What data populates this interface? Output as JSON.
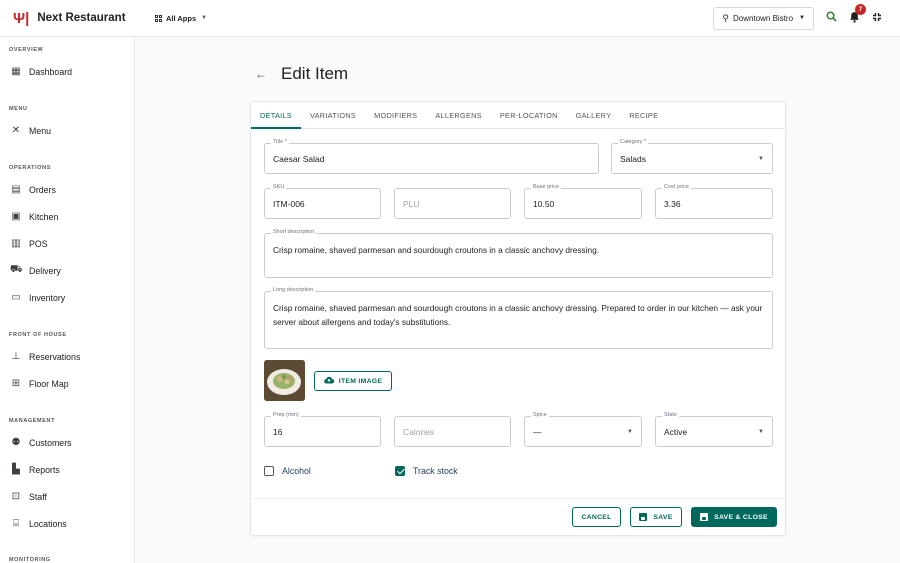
{
  "brand": {
    "name": "Next Restaurant",
    "icon": "fork-knife-icon"
  },
  "apps": {
    "label": "All Apps"
  },
  "location": {
    "label": "Downtown Bistro"
  },
  "notifications": {
    "count": "7"
  },
  "sidebar": {
    "sections": [
      {
        "title": "OVERVIEW",
        "items": [
          {
            "label": "Dashboard",
            "icon": "dashboard-icon"
          }
        ]
      },
      {
        "title": "MENU",
        "items": [
          {
            "label": "Menu",
            "icon": "utensils-icon"
          }
        ]
      },
      {
        "title": "OPERATIONS",
        "items": [
          {
            "label": "Orders",
            "icon": "receipt-icon"
          },
          {
            "label": "Kitchen",
            "icon": "kitchen-icon"
          },
          {
            "label": "POS",
            "icon": "register-icon"
          },
          {
            "label": "Delivery",
            "icon": "truck-icon"
          },
          {
            "label": "Inventory",
            "icon": "inventory-icon"
          }
        ]
      },
      {
        "title": "FRONT OF HOUSE",
        "items": [
          {
            "label": "Reservations",
            "icon": "reservation-icon"
          },
          {
            "label": "Floor Map",
            "icon": "floor-map-icon"
          }
        ]
      },
      {
        "title": "MANAGEMENT",
        "items": [
          {
            "label": "Customers",
            "icon": "people-icon"
          },
          {
            "label": "Reports",
            "icon": "chart-icon"
          },
          {
            "label": "Staff",
            "icon": "badge-icon"
          },
          {
            "label": "Locations",
            "icon": "store-icon"
          }
        ]
      },
      {
        "title": "MONITORING",
        "items": []
      }
    ]
  },
  "page": {
    "title": "Edit Item"
  },
  "tabs": [
    "DETAILS",
    "VARIATIONS",
    "MODIFIERS",
    "ALLERGENS",
    "PER-LOCATION",
    "GALLERY",
    "RECIPE"
  ],
  "form": {
    "title": {
      "label": "Title *",
      "value": "Caesar Salad"
    },
    "category": {
      "label": "Category *",
      "value": "Salads"
    },
    "sku": {
      "label": "SKU",
      "value": "ITM-006"
    },
    "plu": {
      "placeholder": "PLU"
    },
    "base_price": {
      "label": "Base price",
      "value": "10.50"
    },
    "cost_price": {
      "label": "Cost price",
      "value": "3.36"
    },
    "short_description": {
      "label": "Short description",
      "value": "Crisp romaine, shaved parmesan and sourdough croutons in a classic anchovy dressing."
    },
    "long_description": {
      "label": "Long description",
      "value": "Crisp romaine, shaved parmesan and sourdough croutons in a classic anchovy dressing. Prepared to order in our kitchen — ask your server about allergens and today's substitutions."
    },
    "item_image_button": "ITEM IMAGE",
    "prep": {
      "label": "Prep (min)",
      "value": "16"
    },
    "calories": {
      "placeholder": "Calories"
    },
    "spice": {
      "label": "Spice",
      "value": "—"
    },
    "state": {
      "label": "State",
      "value": "Active"
    },
    "alcohol": {
      "label": "Alcohol",
      "checked": false
    },
    "track_stock": {
      "label": "Track stock",
      "checked": true
    }
  },
  "actions": {
    "cancel": "CANCEL",
    "save": "SAVE",
    "save_close": "SAVE & CLOSE"
  },
  "colors": {
    "accent": "#00695c",
    "brand": "#c62828"
  }
}
